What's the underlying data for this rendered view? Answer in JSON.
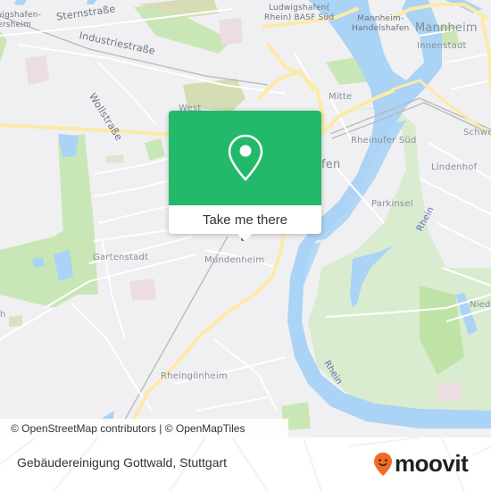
{
  "map": {
    "labels": {
      "sternstrasse": "Sternstraße",
      "industriestrasse": "Industriestraße",
      "wollstrasse": "Wollstraße",
      "ludwigshafen_oggersheim": "Ludwigshafen-\nOggersheim",
      "ludwigshafen_basf_sued": "Ludwigshafen(\nRhein) BASF Süd",
      "mannheim_handelshafen": "Mannheim-\nHandelshafen",
      "mannheim": "Mannheim",
      "innenstadt": "Innenstadt",
      "mitte": "Mitte",
      "west": "West",
      "rheinufer_sued": "Rheinufer Süd",
      "schwetzingerstadt": "Schwe",
      "lindenhof": "Lindenhof",
      "ludwigshafen_partial": "fen",
      "parkinsel": "Parkinsel",
      "rhein_north": "Rhein",
      "rhein_south": "Rhein",
      "gartenstadt": "Gartenstadt",
      "mundenheim": "Mundenheim",
      "niederfeld": "Nied",
      "maudach_partial": "h",
      "rheingoenheim": "Rheingönheim"
    },
    "colors": {
      "background": "#f0f0f2",
      "water": "#aad3f5",
      "park": "#c8e6b4",
      "major_road": "#fde9a9",
      "minor_road": "#ffffff"
    }
  },
  "popup": {
    "icon": "map-pin-icon",
    "button_label": "Take me there",
    "color": "#22b96a"
  },
  "attribution": "© OpenStreetMap contributors | © OpenMapTiles",
  "footer": {
    "title": "Gebäudereinigung Gottwald, Stuttgart",
    "logo_text": "moovit",
    "logo_icon": "moovit-smiley-pin-icon",
    "logo_color": "#f46a25"
  }
}
